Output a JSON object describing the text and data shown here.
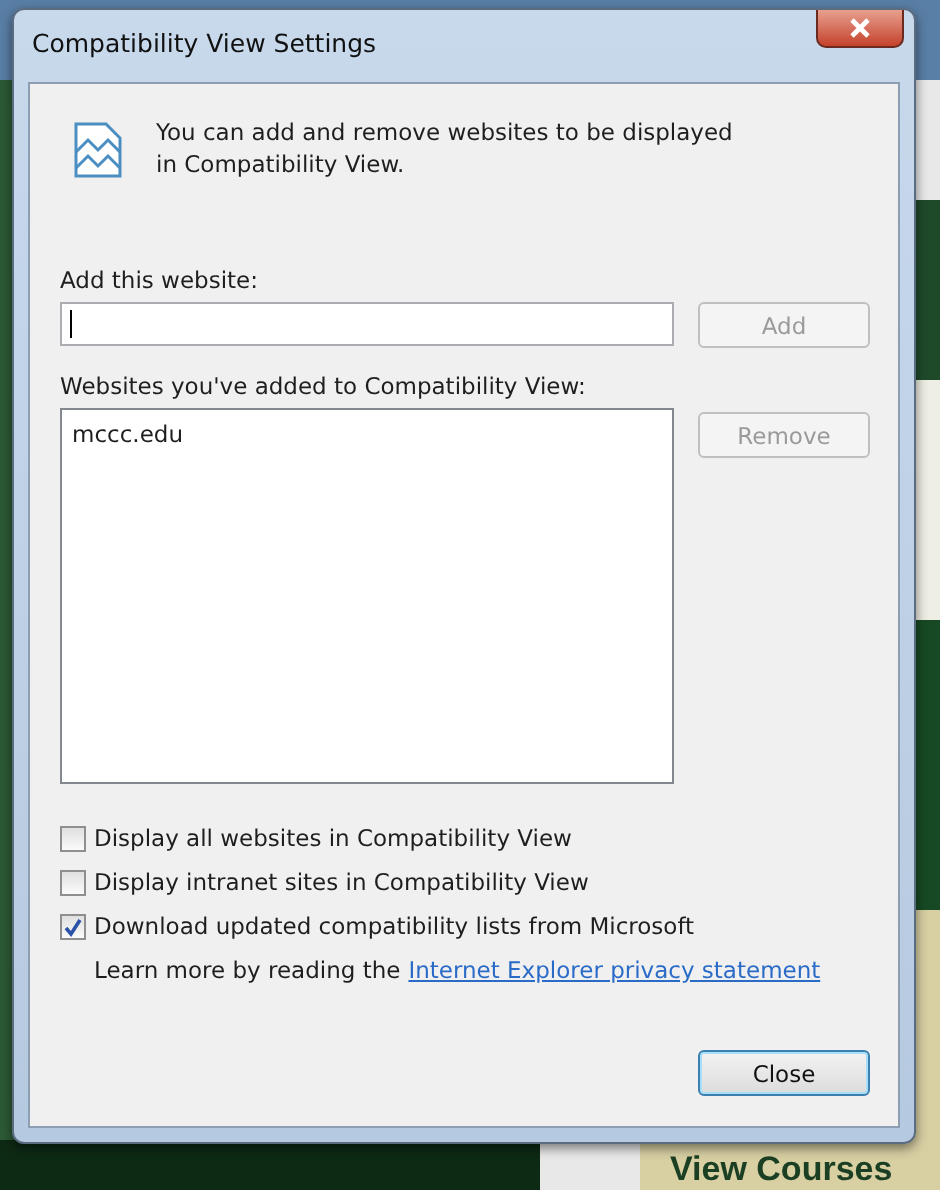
{
  "background": {
    "kind": "picture",
    "banner": "View Courses"
  },
  "window": {
    "title": "Compatibility View Settings"
  },
  "intro": "You can add and remove websites to be displayed in Compatibility View.",
  "add_website": {
    "label": "Add this website:",
    "button": {
      "label": "Add",
      "disabled": true
    }
  },
  "websites": {
    "label": "Websites you've added to Compatibility View:",
    "items": [
      "mccc.edu"
    ],
    "button": {
      "label": "Remove",
      "disabled": true
    }
  },
  "options": [
    {
      "label": "Display all websites in Compatibility View",
      "checked": false
    },
    {
      "label": "Display intranet sites in Compatibility View",
      "checked": false
    },
    {
      "label": "Download updated compatibility lists from Microsoft",
      "checked": true
    }
  ],
  "learn_more": {
    "text": "Learn more by reading the",
    "link": "Internet Explorer privacy statement"
  },
  "buttons": [
    {
      "label": "Close",
      "disabled": false
    }
  ]
}
